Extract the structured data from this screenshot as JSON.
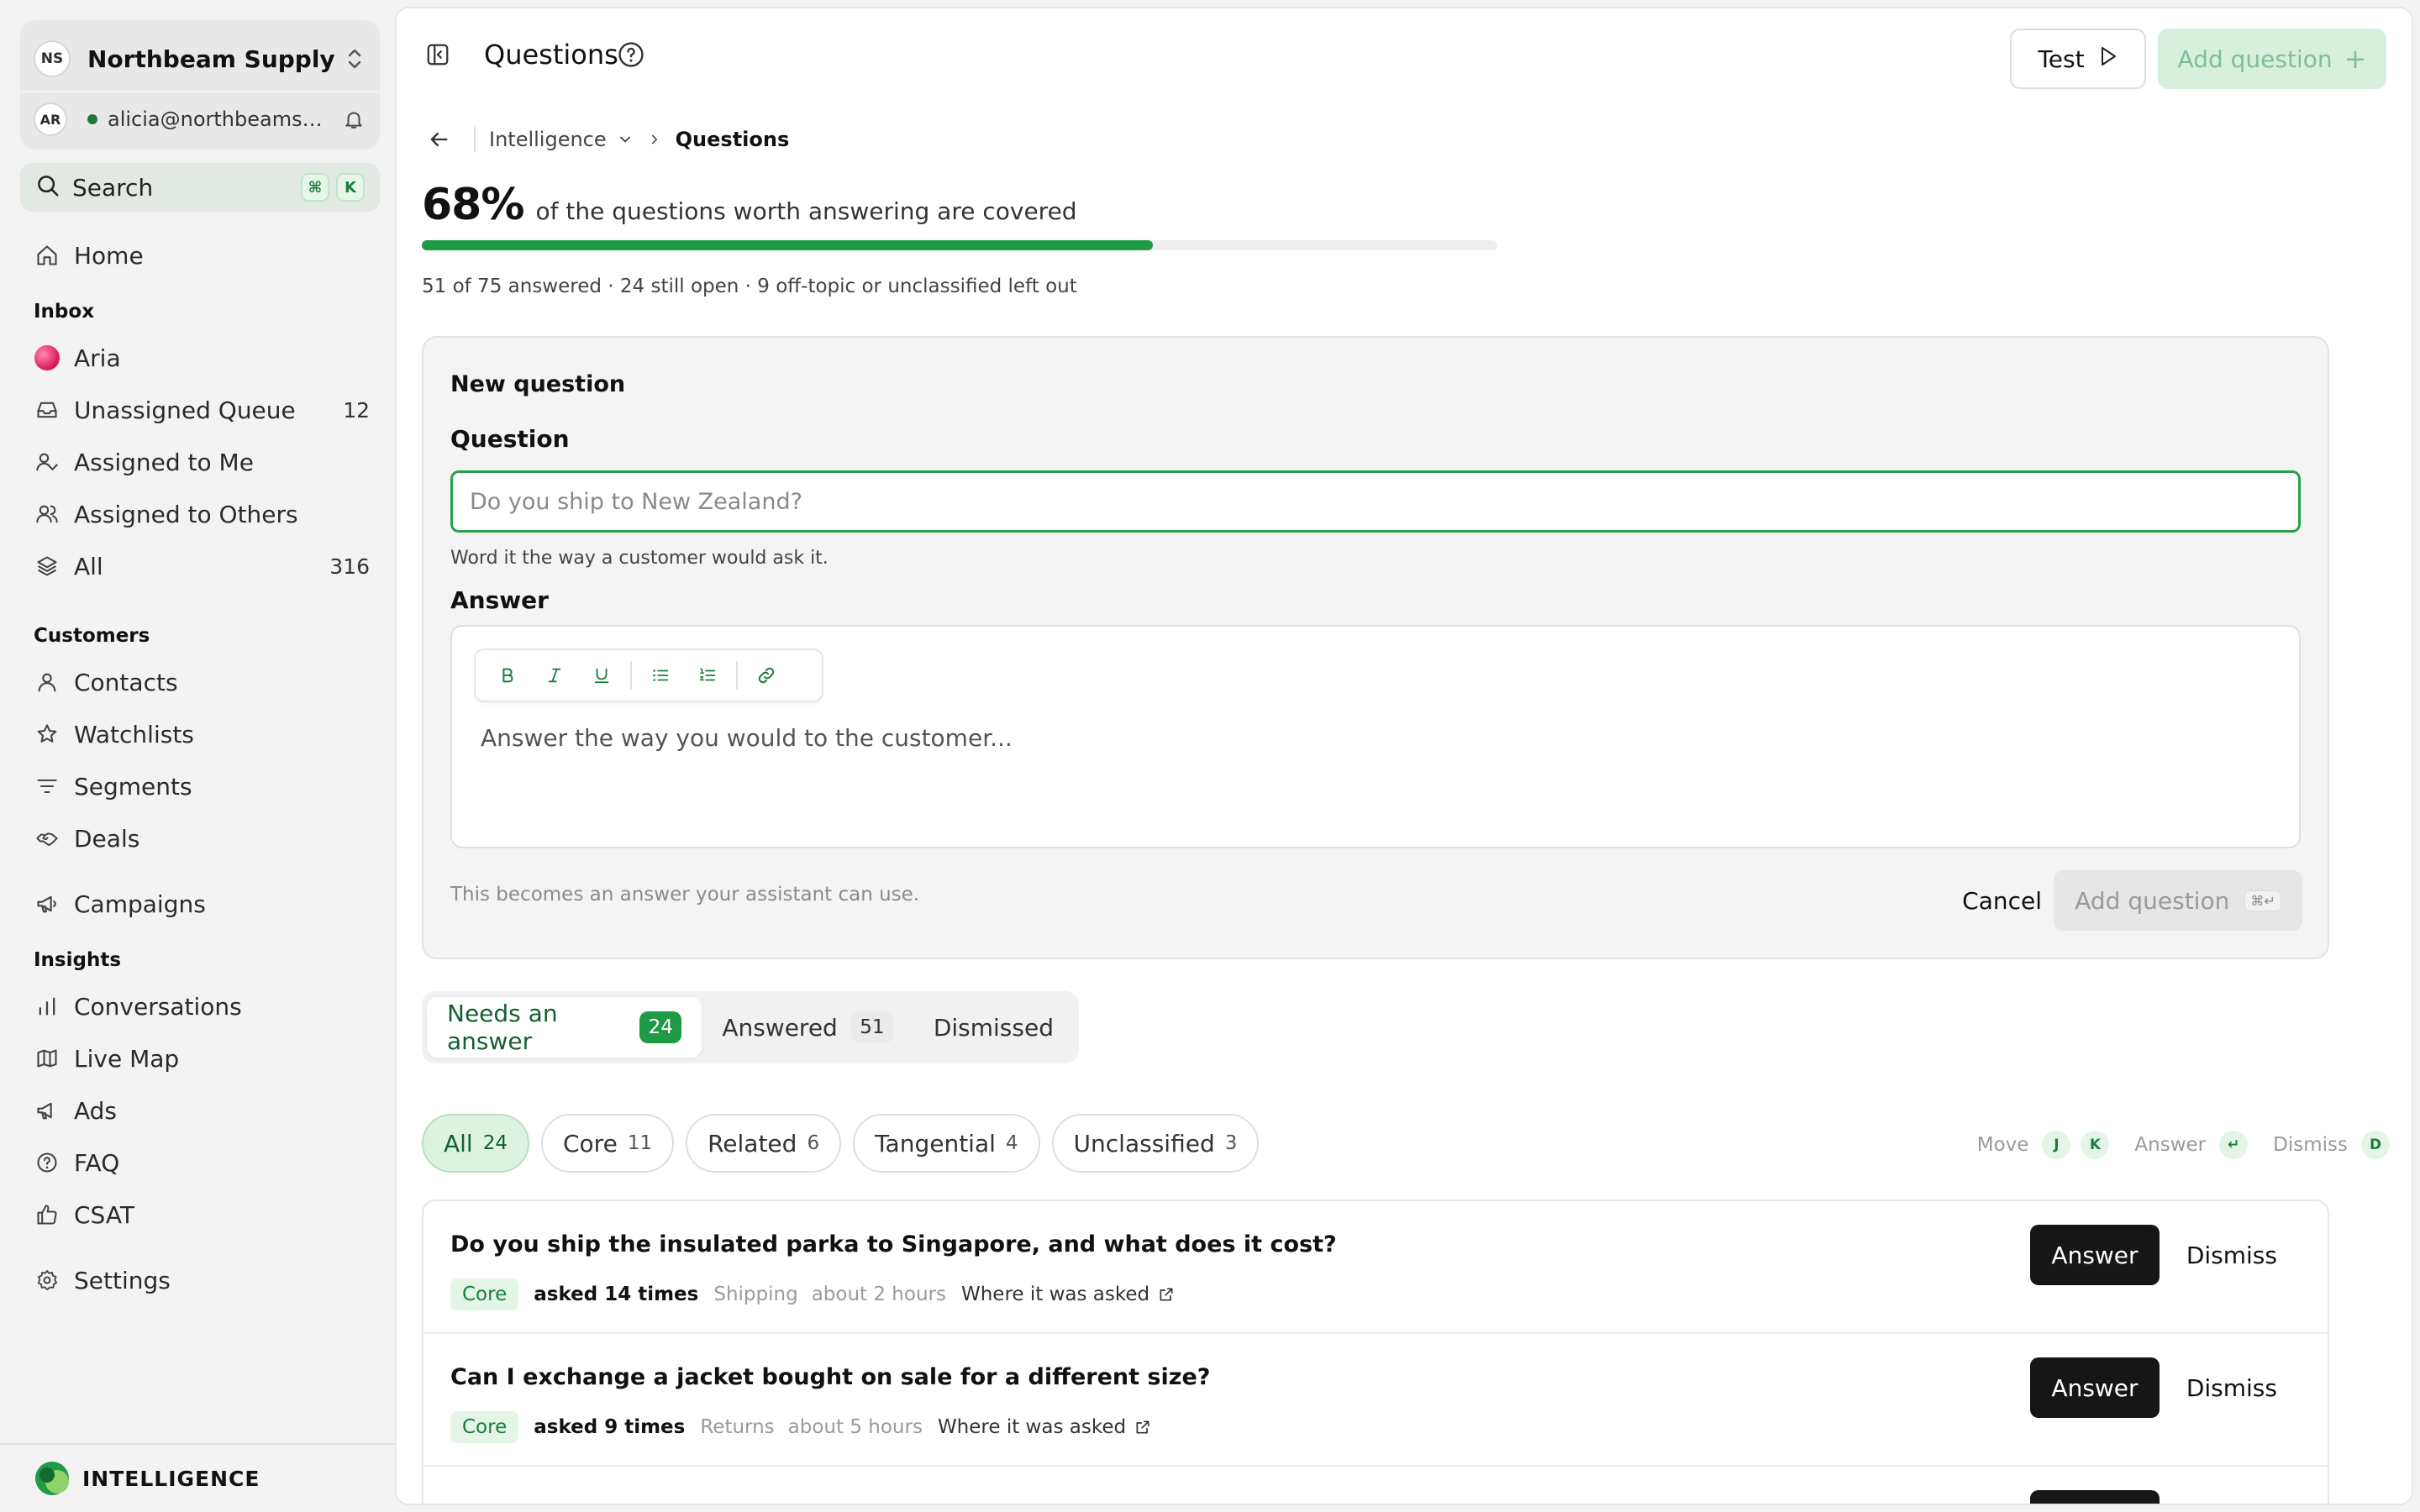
{
  "workspace": {
    "initials": "NS",
    "name": "Northbeam Supply"
  },
  "user": {
    "initials": "AR",
    "email": "alicia@northbeamsu..."
  },
  "search": {
    "label": "Search",
    "shortcut_cmd": "⌘",
    "shortcut_key": "K"
  },
  "nav": {
    "home": "Home",
    "inbox_heading": "Inbox",
    "inbox": [
      {
        "label": "Aria",
        "count": ""
      },
      {
        "label": "Unassigned Queue",
        "count": "12"
      },
      {
        "label": "Assigned to Me",
        "count": ""
      },
      {
        "label": "Assigned to Others",
        "count": ""
      },
      {
        "label": "All",
        "count": "316"
      }
    ],
    "customers_heading": "Customers",
    "customers": [
      "Contacts",
      "Watchlists",
      "Segments",
      "Deals"
    ],
    "campaigns": "Campaigns",
    "insights_heading": "Insights",
    "insights": [
      "Conversations",
      "Live Map",
      "Ads",
      "FAQ",
      "CSAT"
    ],
    "settings": "Settings"
  },
  "brand": {
    "name": "INTELLIGENCE"
  },
  "header": {
    "title": "Questions",
    "test_label": "Test",
    "add_label": "Add question",
    "add_plus": "+"
  },
  "breadcrumb": {
    "parent": "Intelligence",
    "current": "Questions"
  },
  "coverage": {
    "percent_label": "68%",
    "percent_value": 68,
    "description": "of the questions worth answering are covered",
    "summary": "51 of 75 answered · 24 still open · 9 off-topic or unclassified left out"
  },
  "new_question": {
    "heading": "New question",
    "question_label": "Question",
    "question_placeholder": "Do you ship to New Zealand?",
    "question_hint": "Word it the way a customer would ask it.",
    "answer_label": "Answer",
    "answer_placeholder": "Answer the way you would to the customer...",
    "footer_note": "This becomes an answer your assistant can use.",
    "cancel_label": "Cancel",
    "submit_label": "Add question",
    "submit_shortcut": "⌘↵"
  },
  "tabs": [
    {
      "label": "Needs an answer",
      "count": "24"
    },
    {
      "label": "Answered",
      "count": "51"
    },
    {
      "label": "Dismissed",
      "count": ""
    }
  ],
  "filters": [
    {
      "label": "All",
      "count": "24"
    },
    {
      "label": "Core",
      "count": "11"
    },
    {
      "label": "Related",
      "count": "6"
    },
    {
      "label": "Tangential",
      "count": "4"
    },
    {
      "label": "Unclassified",
      "count": "3"
    }
  ],
  "shortcuts": {
    "move_label": "Move",
    "move_key1": "J",
    "move_key2": "K",
    "answer_label": "Answer",
    "answer_key": "↵",
    "dismiss_label": "Dismiss",
    "dismiss_key": "D"
  },
  "questions": [
    {
      "text": "Do you ship the insulated parka to Singapore, and what does it cost?",
      "tag": "Core",
      "asked": "asked 14 times",
      "category": "Shipping",
      "time": "about 2 hours",
      "where": "Where it was asked",
      "answer_label": "Answer",
      "dismiss_label": "Dismiss"
    },
    {
      "text": "Can I exchange a jacket bought on sale for a different size?",
      "tag": "Core",
      "asked": "asked 9 times",
      "category": "Returns",
      "time": "about 5 hours",
      "where": "Where it was asked",
      "answer_label": "Answer",
      "dismiss_label": "Dismiss"
    }
  ],
  "colors": {
    "accent": "#1f9a45",
    "accent_light": "#dcf3e2",
    "dark_button": "#161616"
  }
}
